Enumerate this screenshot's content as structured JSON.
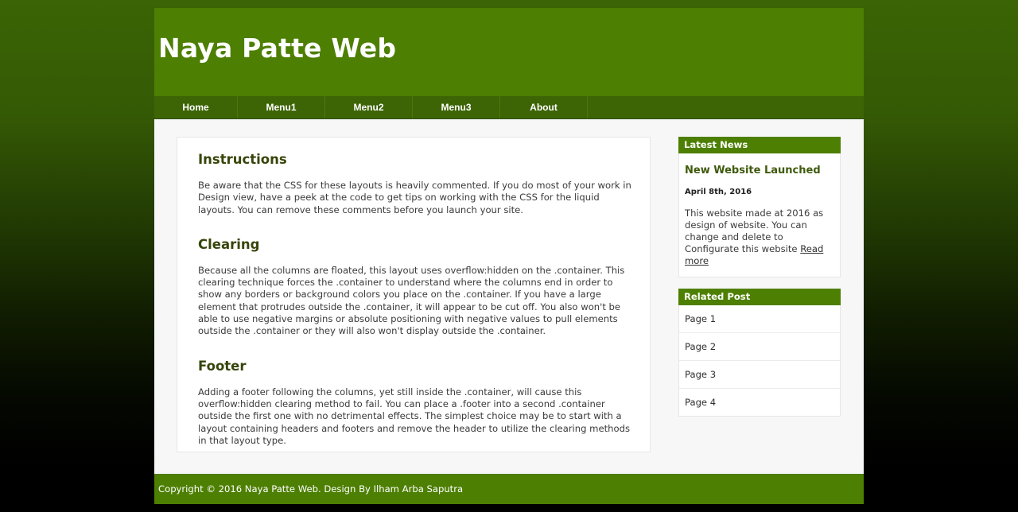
{
  "site": {
    "title": "Naya Patte Web",
    "header_bg": "#4d7f02",
    "nav_bg": "#3d6405",
    "page_bg": "#f7f7f7",
    "accent": "#4d7f02",
    "heading_color": "#36450a"
  },
  "nav": {
    "items": [
      {
        "label": "Home"
      },
      {
        "label": "Menu1"
      },
      {
        "label": "Menu2"
      },
      {
        "label": "Menu3"
      },
      {
        "label": "About"
      }
    ]
  },
  "main": {
    "sections": [
      {
        "heading": "Instructions",
        "body": "Be aware that the CSS for these layouts is heavily commented. If you do most of your work in Design view, have a peek at the code to get tips on working with the CSS for the liquid layouts. You can remove these comments before you launch your site."
      },
      {
        "heading": "Clearing",
        "body": "Because all the columns are floated, this layout uses overflow:hidden on the .container. This clearing technique forces the .container to understand where the columns end in order to show any borders or background colors you place on the .container. If you have a large element that protrudes outside the .container, it will appear to be cut off. You also won't be able to use negative margins or absolute positioning with negative values to pull elements outside the .container or they will also won't display outside the .container."
      },
      {
        "heading": "Footer",
        "body": "Adding a footer following the columns, yet still inside the .container, will cause this overflow:hidden clearing method to fail. You can place a .footer into a second .container outside the first one with no detrimental effects. The simplest choice may be to start with a layout containing headers and footers and remove the header to utilize the clearing methods in that layout type."
      }
    ]
  },
  "sidebar": {
    "latest_news": {
      "header": "Latest News",
      "post_title": "New Website Launched",
      "date": "April 8th, 2016",
      "excerpt": "This website made at 2016 as design of website. You can change and delete to Configurate this website ",
      "read_more": "Read more"
    },
    "related_post": {
      "header": "Related Post",
      "items": [
        {
          "label": "Page 1"
        },
        {
          "label": "Page 2"
        },
        {
          "label": "Page 3"
        },
        {
          "label": "Page 4"
        }
      ]
    }
  },
  "footer": {
    "copyright": "Copyright © 2016 Naya Patte Web. Design By Ilham Arba Saputra"
  }
}
